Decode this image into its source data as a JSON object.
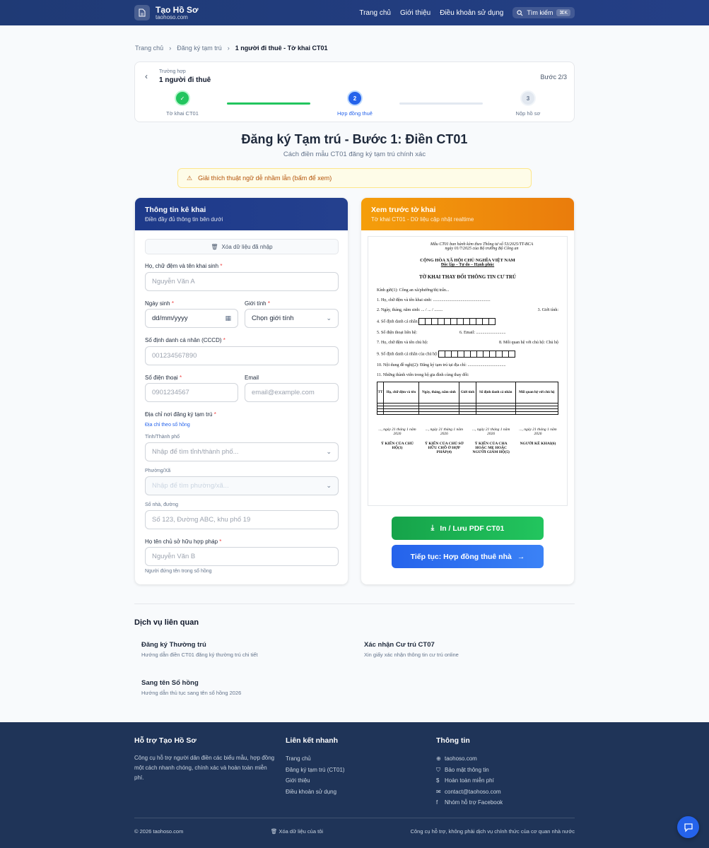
{
  "header": {
    "brand": "Tạo Hồ Sơ",
    "domain": "taohoso.com",
    "nav": [
      "Trang chủ",
      "Giới thiệu",
      "Điều khoản sử dụng"
    ],
    "search_label": "Tìm kiếm",
    "search_kbd": "⌘K"
  },
  "breadcrumb": {
    "items": [
      "Trang chủ",
      "Đăng ký tạm trú"
    ],
    "current": "1 người đi thuê - Tờ khai CT01"
  },
  "stepper": {
    "case_label": "Trường hợp",
    "case_value": "1 người đi thuê",
    "counter": "Bước 2/3",
    "steps": [
      {
        "label": "Tờ khai CT01",
        "state": "done",
        "num": "✓"
      },
      {
        "label": "Hợp đồng thuê",
        "state": "active",
        "num": "2"
      },
      {
        "label": "Nộp hồ sơ",
        "state": "todo",
        "num": "3"
      }
    ]
  },
  "page": {
    "title": "Đăng ký Tạm trú - Bước 1: Điền CT01",
    "subtitle": "Cách điền mẫu CT01 đăng ký tạm trú chính xác",
    "warning": "Giải thích thuật ngữ dễ nhầm lẫn (bấm để xem)"
  },
  "form": {
    "title": "Thông tin kê khai",
    "subtitle": "Điền đầy đủ thông tin bên dưới",
    "clear_label": "Xóa dữ liệu đã nhập",
    "name": {
      "label": "Họ, chữ đệm và tên khai sinh",
      "required": "*",
      "placeholder": "Nguyễn Văn A"
    },
    "dob": {
      "label": "Ngày sinh",
      "required": "*",
      "value": "dd/mm/yyyy"
    },
    "gender": {
      "label": "Giới tính",
      "required": "*",
      "value": "Chọn giới tính"
    },
    "cccd": {
      "label": "Số định danh cá nhân (CCCD)",
      "required": "*",
      "placeholder": "001234567890"
    },
    "phone": {
      "label": "Số điện thoại",
      "required": "*",
      "placeholder": "0901234567"
    },
    "email": {
      "label": "Email",
      "placeholder": "email@example.com"
    },
    "address": {
      "label": "Địa chỉ nơi đăng ký tạm trú",
      "required": "*",
      "hint": "Địa chỉ theo sổ hồng",
      "province_label": "Tỉnh/Thành phố",
      "province_placeholder": "Nhập để tìm tỉnh/thành phố...",
      "ward_label": "Phường/Xã",
      "ward_placeholder": "Nhập để tìm phường/xã...",
      "street_label": "Số nhà, đường",
      "street_placeholder": "Số 123, Đường ABC, khu phố 19"
    },
    "owner": {
      "label": "Họ tên chủ sở hữu hợp pháp",
      "required": "*",
      "placeholder": "Nguyễn Văn B",
      "hint": "Người đứng tên trong sổ hồng"
    }
  },
  "preview": {
    "title": "Xem trước tờ khai",
    "subtitle": "Tờ khai CT01 - Dữ liệu cập nhật realtime",
    "doc": {
      "note1": "Mẫu CT01 ban hành kèm theo Thông tư số 53/2025/TT-BCA",
      "note2": "ngày 01/7/2025 của Bộ trưởng Bộ Công an",
      "nation": "CỘNG HÒA XÃ HỘI CHỦ NGHĨA VIỆT NAM",
      "motto": "Độc lập – Tự do – Hạnh phúc",
      "title": "TỜ KHAI THAY ĐỔI THÔNG TIN CƯ TRÚ",
      "to": "Kính gửi(1): Công an xã/phường/thị trấn...",
      "l1": "1. Họ, chữ đệm và tên khai sinh: ......................................................",
      "l2": "2. Ngày, tháng, năm sinh:       ...      /       ...     /       ........",
      "l2b": "3. Giới tính:",
      "l4": "4. Số định danh cá nhân:",
      "l5": "5. Số điện thoại liên hệ:",
      "l6": "6. Email: ............................",
      "l7": "7. Họ, chữ đệm và tên chủ hộ:",
      "l8": "8. Mối quan hệ với chủ hộ:   Chủ hộ",
      "l9": "9. Số định danh cá nhân của chủ hộ:",
      "l10": "10. Nội dung đề nghị(2): Đăng ký tạm trú tại địa chỉ: ....................................",
      "l11": "11. Những thành viên trong hộ gia đình cùng thay đổi:",
      "cols": [
        "TT",
        "Họ, chữ đệm và tên",
        "Ngày, tháng, năm sinh",
        "Giới tính",
        "Số định danh cá nhân",
        "Mối quan hệ với chủ hộ"
      ],
      "dates": [
        "..., ngày 21 tháng 1 năm 2026",
        "..., ngày 21 tháng 1 năm 2026",
        "..., ngày 21 tháng 1 năm 2026",
        "..., ngày 21 tháng 1 năm 2026"
      ],
      "signers": [
        "Ý KIẾN CỦA CHỦ HỘ(3)",
        "Ý KIẾN CỦA CHỦ SỞ HỮU CHỖ Ở HỢP PHÁP(4)",
        "Ý KIẾN CỦA CHA HOẶC MẸ HOẶC NGƯỜI GIÁM HỘ(5)",
        "NGƯỜI KÊ KHAI(6)"
      ]
    },
    "print_label": "In / Lưu PDF CT01",
    "next_label": "Tiếp tục: Hợp đồng thuê nhà"
  },
  "related": {
    "title": "Dịch vụ liên quan",
    "items": [
      {
        "t": "Đăng ký Thường trú",
        "s": "Hướng dẫn điền CT01 đăng ký thường trú chi tiết"
      },
      {
        "t": "Xác nhận Cư trú CT07",
        "s": "Xin giấy xác nhận thông tin cư trú online"
      },
      {
        "t": "Sang tên Sổ hồng",
        "s": "Hướng dẫn thủ tục sang tên sổ hồng 2026"
      }
    ]
  },
  "footer": {
    "c1_title": "Hỗ trợ Tạo Hồ Sơ",
    "c1_text": "Công cụ hỗ trợ người dân điền các biểu mẫu, hợp đồng một cách nhanh chóng, chính xác và hoàn toàn miễn phí.",
    "c2_title": "Liên kết nhanh",
    "c2_links": [
      "Trang chủ",
      "Đăng ký tạm trú (CT01)",
      "Giới thiệu",
      "Điều khoản sử dụng"
    ],
    "c3_title": "Thông tin",
    "c3_items": [
      "taohoso.com",
      "Bảo mật thông tin",
      "Hoàn toàn miễn phí",
      "contact@taohoso.com",
      "Nhóm hỗ trợ Facebook"
    ],
    "copyright": "© 2026 taohoso.com",
    "clear_data": "Xóa dữ liệu của tôi",
    "disclaimer": "Công cụ hỗ trợ, không phải dịch vụ chính thức của cơ quan nhà nước"
  },
  "colors": {
    "navy": "#1f3a75",
    "green": "#22c55e",
    "blue": "#2563eb",
    "orange": "#f97316"
  }
}
